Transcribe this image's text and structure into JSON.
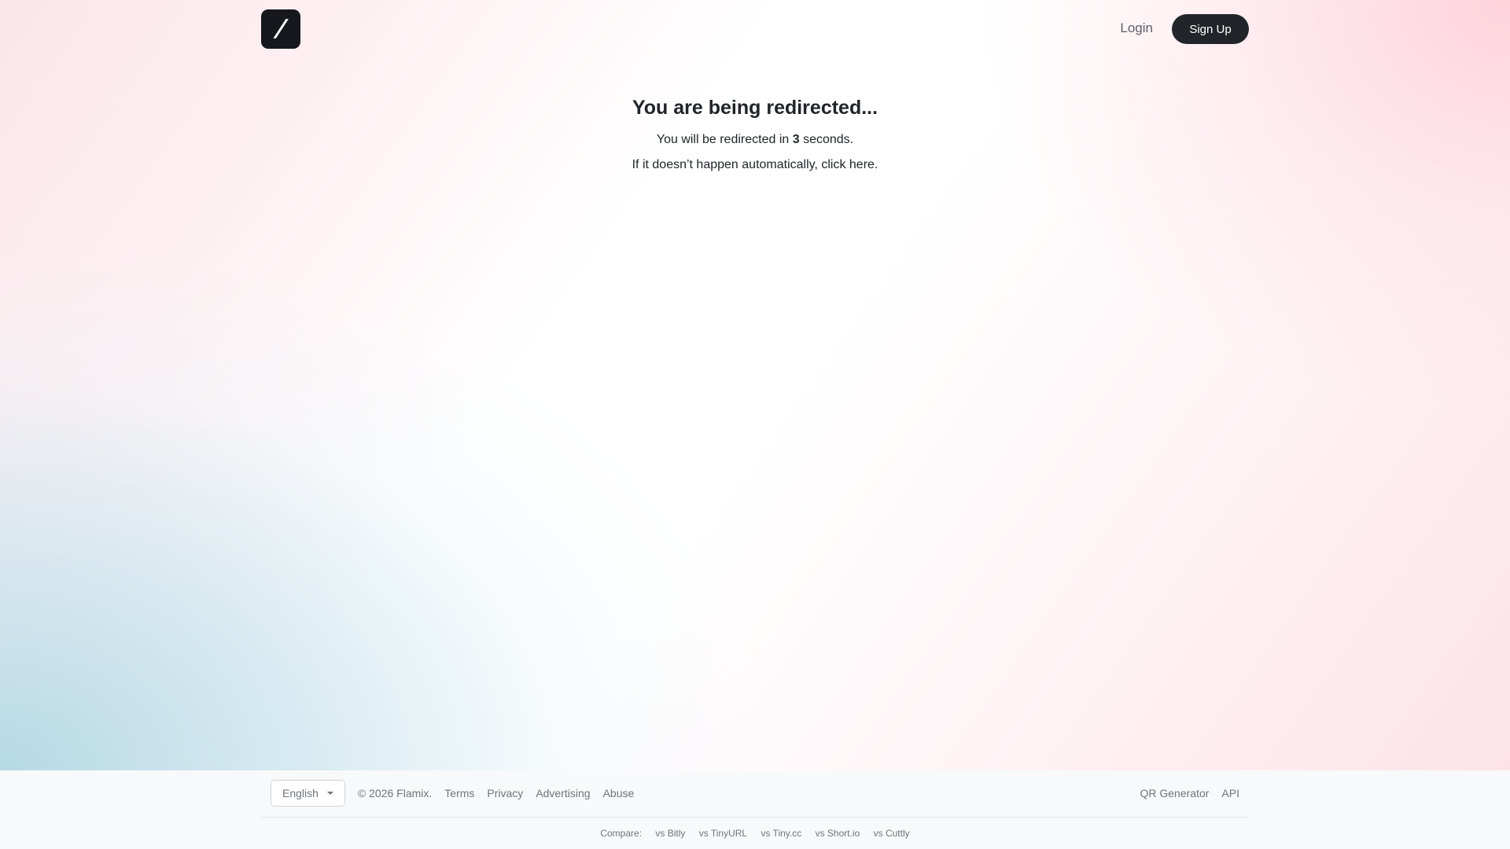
{
  "header": {
    "logo_glyph": "/",
    "login_label": "Login",
    "signup_label": "Sign Up"
  },
  "main": {
    "title": "You are being redirected...",
    "countdown_prefix": "You will be redirected in ",
    "countdown_value": "3",
    "countdown_suffix": " seconds.",
    "fallback_prefix": "If it doesn’t happen automatically, ",
    "fallback_link": "click here",
    "fallback_suffix": "."
  },
  "footer": {
    "language_selected": "English",
    "copyright": "© 2026 Flamix.",
    "links": [
      "Terms",
      "Privacy",
      "Advertising",
      "Abuse"
    ],
    "right_links": [
      "QR Generator",
      "API"
    ],
    "compare_label": "Compare:",
    "compare_links": [
      "vs Bitly",
      "vs TinyURL",
      "vs Tiny.cc",
      "vs Short.io",
      "vs Cuttly"
    ]
  },
  "colors": {
    "button_dark": "#212529",
    "logo_bg": "#16181d",
    "footer_bg": "#f8f9fa",
    "muted_text": "#6c757d"
  },
  "icons": {
    "logo": "slash-logo-icon",
    "language_caret": "caret-down-icon"
  }
}
